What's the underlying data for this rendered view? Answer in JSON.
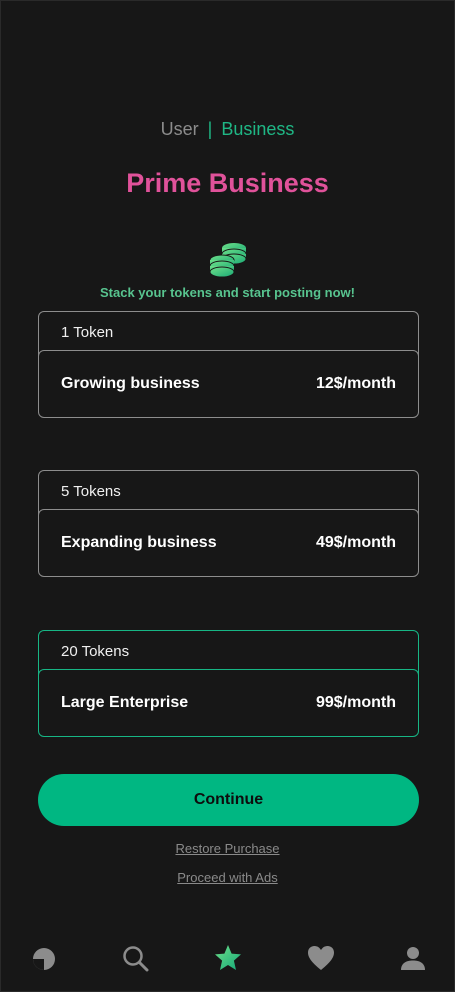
{
  "toggle": {
    "user": "User",
    "separator": "|",
    "business": "Business"
  },
  "title": "Prime Business",
  "tagline": "Stack your tokens and start posting now!",
  "plans": [
    {
      "tokens": "1 Token",
      "name": "Growing business",
      "price": "12$/month",
      "selected": false
    },
    {
      "tokens": "5 Tokens",
      "name": "Expanding business",
      "price": "49$/month",
      "selected": false
    },
    {
      "tokens": "20 Tokens",
      "name": "Large Enterprise",
      "price": "99$/month",
      "selected": true
    }
  ],
  "continue_label": "Continue",
  "links": {
    "restore": "Restore Purchase",
    "ads": "Proceed with Ads"
  },
  "nav": [
    {
      "icon": "explore-icon",
      "active": false
    },
    {
      "icon": "search-icon",
      "active": false
    },
    {
      "icon": "star-icon",
      "active": true
    },
    {
      "icon": "heart-icon",
      "active": false
    },
    {
      "icon": "profile-icon",
      "active": false
    }
  ],
  "colors": {
    "accent": "#00b782",
    "title": "#e0529a",
    "background": "#171717",
    "border": "#8d8d8d"
  }
}
